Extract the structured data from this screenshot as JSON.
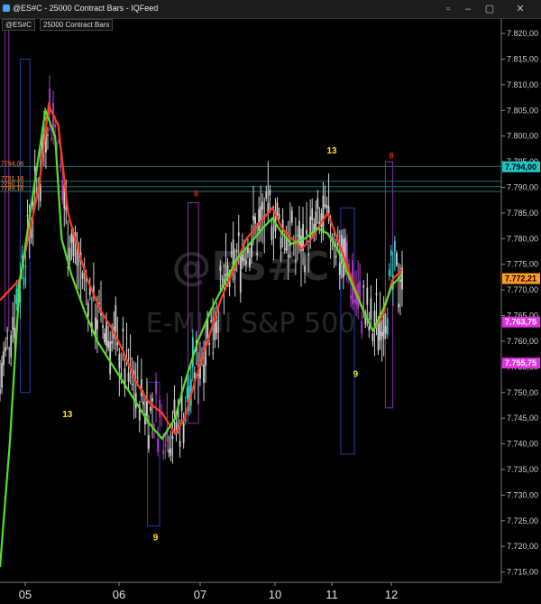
{
  "window": {
    "title": "@ES#C - 25000 Contract Bars - IQFeed",
    "tags": [
      "@ES#C",
      "25000 Contract Bars"
    ],
    "watermark_symbol": "@ES#C",
    "watermark_name": "E-MINI S&P 500"
  },
  "colors": {
    "bg": "#000000",
    "candle": "#cfcfcf",
    "candle_down_highlight": "#b03cc8",
    "candle_up_highlight": "#2ed3d3",
    "ma_fast": "#ff3b1f",
    "ma_slow": "#55e02a",
    "tdseq_count": "#ffe21a",
    "tdseq_mark": "#e02020",
    "box_purple": "#8a2ea8",
    "box_blue": "#2a3aa8"
  },
  "chart_data": {
    "type": "candlestick",
    "x_labels": [
      "05",
      "06",
      "07",
      "10",
      "11",
      "12"
    ],
    "y_ticks": [
      "7.715,00",
      "7.720,00",
      "7.725,00",
      "7.730,00",
      "7.735,00",
      "7.740,00",
      "7.745,00",
      "7.750,00",
      "7.755,00",
      "7.760,00",
      "7.765,00",
      "7.770,00",
      "7.775,00",
      "7.780,00",
      "7.785,00",
      "7.790,00",
      "7.795,00",
      "7.800,00",
      "7.805,00",
      "7.810,00",
      "7.815,00",
      "7.820,00"
    ],
    "ylim": [
      7713.0,
      7823.0
    ],
    "price_tags": [
      {
        "label": "7.794,00",
        "value": 7794.0,
        "bg": "#1cc6c6",
        "fg": "#000000"
      },
      {
        "label": "7.772,21",
        "value": 7772.21,
        "bg": "#ff9a1f",
        "fg": "#000000"
      },
      {
        "label": "7.763,75",
        "value": 7763.75,
        "bg": "#e030e0",
        "fg": "#ffffff"
      },
      {
        "label": "7.755,75",
        "value": 7755.75,
        "bg": "#e030e0",
        "fg": "#ffffff"
      }
    ],
    "left_levels": [
      {
        "label": "7794,06",
        "value": 7794.06
      },
      {
        "label": "7791,18",
        "value": 7791.18
      },
      {
        "label": "7790,13",
        "value": 7790.13
      },
      {
        "label": "7789,18",
        "value": 7789.18
      }
    ],
    "annotations": [
      {
        "text": "13",
        "x": 5.45,
        "value": 7745.2
      },
      {
        "text": "9",
        "x": 6.45,
        "value": 7721.2
      },
      {
        "text": "13",
        "x": 11.0,
        "value": 7796.6
      },
      {
        "text": "9",
        "x": 11.4,
        "value": 7753.0
      }
    ],
    "marks": [
      {
        "text": "8",
        "x": 6.95,
        "value": 7788.2
      },
      {
        "text": "8",
        "x": 12.0,
        "value": 7795.6
      }
    ],
    "boxes": [
      {
        "x0": 4.2,
        "x1": 4.35,
        "y0": 7762,
        "y1": 7821,
        "kind": "purple"
      },
      {
        "x0": 4.8,
        "x1": 5.05,
        "y0": 7750,
        "y1": 7815,
        "kind": "blue"
      },
      {
        "x0": 6.35,
        "x1": 6.5,
        "y0": 7724,
        "y1": 7752,
        "kind": "blue"
      },
      {
        "x0": 6.85,
        "x1": 6.98,
        "y0": 7744,
        "y1": 7787,
        "kind": "purple"
      },
      {
        "x0": 11.15,
        "x1": 11.38,
        "y0": 7738,
        "y1": 7786,
        "kind": "blue"
      },
      {
        "x0": 11.9,
        "x1": 12.03,
        "y0": 7747,
        "y1": 7795,
        "kind": "purple"
      }
    ],
    "ma_fast": [
      [
        4.0,
        7768
      ],
      [
        4.3,
        7772
      ],
      [
        4.6,
        7790
      ],
      [
        4.75,
        7806
      ],
      [
        4.9,
        7802
      ],
      [
        5.05,
        7785
      ],
      [
        5.2,
        7778
      ],
      [
        5.35,
        7772
      ],
      [
        5.55,
        7766
      ],
      [
        5.75,
        7762
      ],
      [
        5.9,
        7758
      ],
      [
        6.1,
        7752
      ],
      [
        6.3,
        7748
      ],
      [
        6.5,
        7746
      ],
      [
        6.7,
        7742
      ],
      [
        6.85,
        7745
      ],
      [
        7.0,
        7752
      ],
      [
        7.2,
        7760
      ],
      [
        7.4,
        7768
      ],
      [
        7.6,
        7774
      ],
      [
        7.8,
        7780
      ],
      [
        8.0,
        7783
      ],
      [
        8.2,
        7786
      ],
      [
        8.35,
        7782
      ],
      [
        8.5,
        7780
      ],
      [
        8.65,
        7778
      ],
      [
        8.8,
        7780
      ],
      [
        8.95,
        7783
      ],
      [
        9.05,
        7785
      ],
      [
        9.2,
        7780
      ],
      [
        9.4,
        7773
      ],
      [
        9.6,
        7766
      ],
      [
        9.75,
        7762
      ],
      [
        9.9,
        7765
      ],
      [
        10.05,
        7772
      ],
      [
        10.2,
        7774
      ]
    ],
    "ma_slow": [
      [
        4.0,
        7716
      ],
      [
        4.15,
        7740
      ],
      [
        4.3,
        7771
      ],
      [
        4.5,
        7788
      ],
      [
        4.7,
        7805
      ],
      [
        4.85,
        7800
      ],
      [
        4.95,
        7780
      ],
      [
        5.1,
        7773
      ],
      [
        5.3,
        7766
      ],
      [
        5.5,
        7760
      ],
      [
        5.7,
        7756
      ],
      [
        5.9,
        7752
      ],
      [
        6.1,
        7748
      ],
      [
        6.3,
        7744
      ],
      [
        6.5,
        7741
      ],
      [
        6.7,
        7745
      ],
      [
        6.85,
        7752
      ],
      [
        7.05,
        7760
      ],
      [
        7.25,
        7766
      ],
      [
        7.45,
        7771
      ],
      [
        7.65,
        7776
      ],
      [
        7.85,
        7779
      ],
      [
        8.05,
        7782
      ],
      [
        8.2,
        7784
      ],
      [
        8.35,
        7781
      ],
      [
        8.5,
        7779
      ],
      [
        8.7,
        7780
      ],
      [
        8.9,
        7782
      ],
      [
        9.05,
        7781
      ],
      [
        9.2,
        7778
      ],
      [
        9.4,
        7772
      ],
      [
        9.6,
        7766
      ],
      [
        9.75,
        7762
      ],
      [
        9.9,
        7766
      ],
      [
        10.05,
        7771
      ],
      [
        10.2,
        7773
      ]
    ]
  }
}
